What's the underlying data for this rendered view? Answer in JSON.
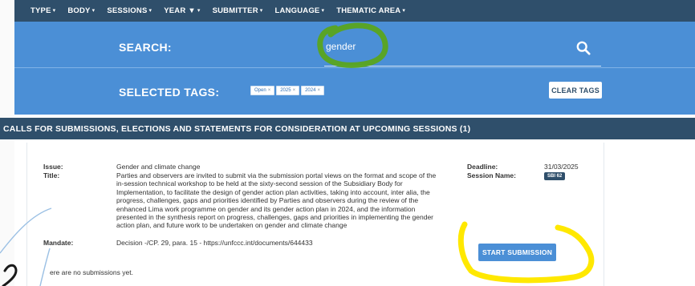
{
  "nav": {
    "items": [
      {
        "label": "TYPE",
        "caret": "▾"
      },
      {
        "label": "BODY",
        "caret": "▾"
      },
      {
        "label": "SESSIONS",
        "caret": "▾"
      },
      {
        "label": "YEAR ▼",
        "caret": "▾"
      },
      {
        "label": "SUBMITTER",
        "caret": "▾"
      },
      {
        "label": "LANGUAGE",
        "caret": "▾"
      },
      {
        "label": "THEMATIC AREA",
        "caret": "▾"
      }
    ]
  },
  "search": {
    "label": "SEARCH:",
    "value": "gender",
    "icon": "search-icon"
  },
  "tags": {
    "label": "SELECTED TAGS:",
    "items": [
      {
        "text": "Open",
        "remove": "×"
      },
      {
        "text": "2025",
        "remove": "×"
      },
      {
        "text": "2024",
        "remove": "×"
      }
    ],
    "clear_label": "CLEAR TAGS"
  },
  "calls": {
    "header": "CALLS FOR SUBMISSIONS, ELECTIONS AND STATEMENTS FOR CONSIDERATION AT UPCOMING SESSIONS (1)",
    "item": {
      "issue_label": "Issue:",
      "issue": "Gender and climate change",
      "title_label": "Title:",
      "title_lines": [
        "Parties and observers are invited to submit via the submission portal views on the format and scope of the",
        "in-session technical workshop to be held at the sixty-second session of the Subsidiary Body for",
        "Implementation, to facilitate the design of gender action plan activities, taking into account, inter alia, the",
        "progress, challenges, gaps and priorities identified by Parties and observers during the review of the",
        "enhanced Lima work programme on gender and its gender action plan in 2024, and the information",
        "presented in the synthesis report on progress, challenges, gaps and priorities in implementing the gender",
        "action plan, and future work to be undertaken on gender and climate change"
      ],
      "mandate_label": "Mandate:",
      "mandate": "Decision -/CP. 29, para. 15 - https://unfccc.int/documents/644433",
      "deadline_label": "Deadline:",
      "deadline": "31/03/2025",
      "session_label": "Session Name:",
      "session_badge": "SBI 62",
      "start_label": "START SUBMISSION",
      "no_submissions": "ere are no submissions yet."
    }
  },
  "colors": {
    "nav": "#2f4f6b",
    "band": "#4b8fd6",
    "green_annotation": "#5aa51e",
    "yellow_annotation": "#ffe800"
  }
}
